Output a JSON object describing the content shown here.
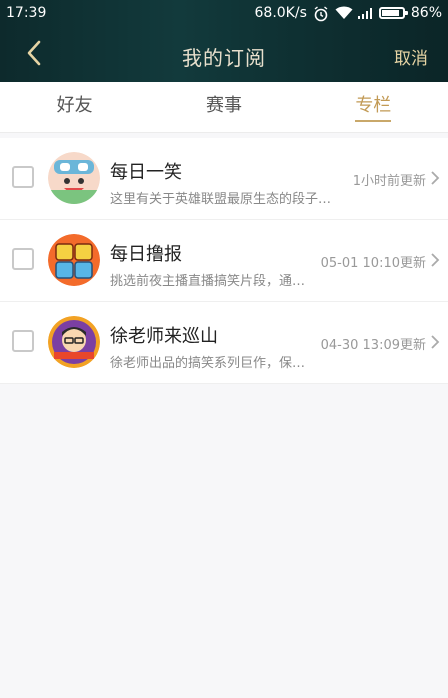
{
  "status_bar": {
    "time": "17:39",
    "net_speed": "68.0K/s",
    "battery": "86%",
    "battery_level": 0.86
  },
  "header": {
    "title": "我的订阅",
    "cancel_label": "取消",
    "back_icon": "chevron-left-icon"
  },
  "tabs": [
    {
      "label": "好友",
      "active": false
    },
    {
      "label": "赛事",
      "active": false
    },
    {
      "label": "专栏",
      "active": true
    }
  ],
  "subscriptions": [
    {
      "name": "每日一笑",
      "desc": "这里有关于英雄联盟最原生态的段子…",
      "updated": "1小时前更新"
    },
    {
      "name": "每日撸报",
      "desc": "挑选前夜主播直播搞笑片段，通…",
      "updated": "05-01 10:10更新"
    },
    {
      "name": "徐老师来巡山",
      "desc": "徐老师出品的搞笑系列巨作，保…",
      "updated": "04-30 13:09更新"
    }
  ],
  "colors": {
    "accent": "#c29a55",
    "header_bg": "#0f3234"
  }
}
